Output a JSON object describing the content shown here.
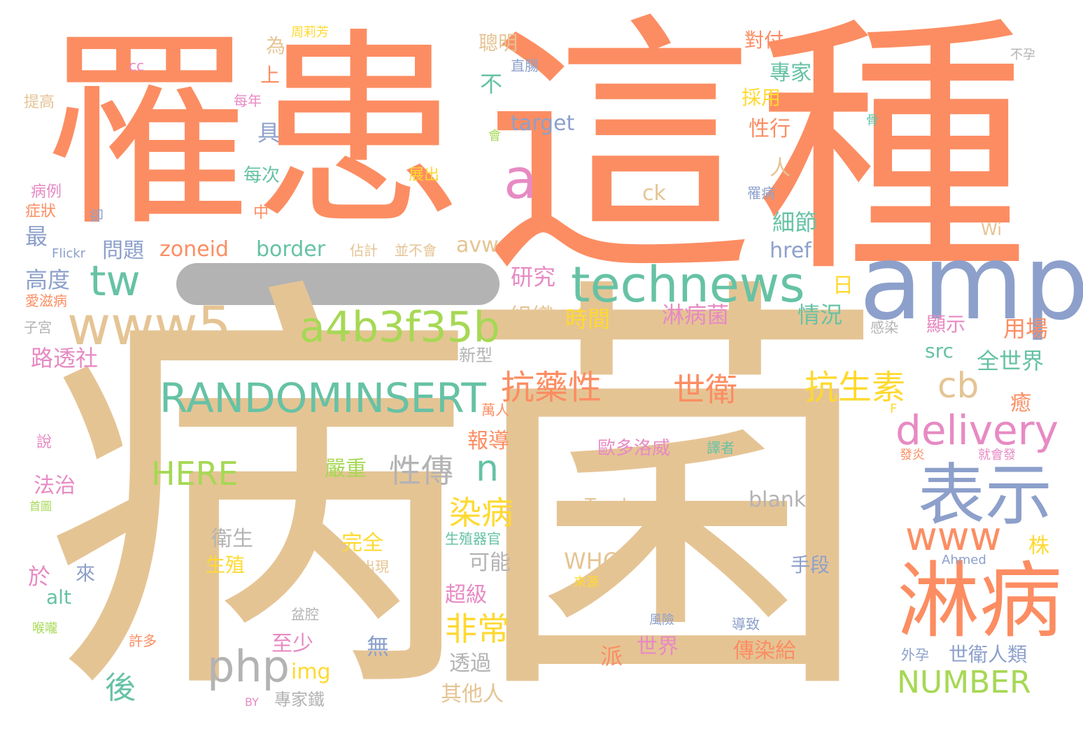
{
  "colors": {
    "orange": "#fc8d62",
    "tan": "#e5c494",
    "blue": "#8da0cb",
    "green": "#66c2a5",
    "pink": "#e78ac3",
    "lime": "#a6d854",
    "yellow": "#ffd92f",
    "gray": "#b3b3b3"
  },
  "words": {
    "w1": "罹患",
    "w2": "這種",
    "w3": "病菌",
    "w4": "amp",
    "w5": "淋病",
    "w6": "表示",
    "w7": "technews",
    "w8": "www5",
    "w9": "a4b3f35b",
    "w10": "RANDOMINSERT",
    "w11": "tw",
    "w12": "delivery",
    "w13": "www",
    "w14": "php",
    "w15": "抗藥性",
    "w16": "抗生素",
    "w17": "世衛",
    "w18": "NUMBER",
    "w19": "HERE",
    "w20": "a",
    "w21": "cb",
    "w22": "n",
    "w23": "性傳",
    "w24": "染病",
    "w25": "非常",
    "w26": "後",
    "w27": "淋病菌",
    "w28": "組織",
    "w29": "時間",
    "w30": "研究",
    "w31": "情況",
    "w32": "顯示",
    "w33": "用場",
    "w34": "全世界",
    "w35": "src",
    "w36": "路透社",
    "w37": "高度",
    "w38": "問題",
    "w39": "zoneid",
    "w40": "border",
    "w41": "avw",
    "w42": "href",
    "w43": "細節",
    "w44": "專家",
    "w45": "性行",
    "w46": "target",
    "w47": "ck",
    "w48": "聰明",
    "w49": "對付",
    "w50": "採用",
    "w51": "報導",
    "w52": "嚴重",
    "w53": "法治",
    "w54": "衛生",
    "w55": "可能",
    "w56": "完全",
    "w57": "超級",
    "w58": "至少",
    "w59": "透過",
    "w60": "其他人",
    "w61": "img",
    "w62": "生殖",
    "w63": "世界",
    "w64": "傳染給",
    "w65": "世衛人類",
    "w66": "手段",
    "w67": "WHO",
    "w68": "blank",
    "w69": "Teodora",
    "w70": "歐多洛威",
    "w71": "生殖器官",
    "w72": "每次",
    "w73": "展出",
    "w74": "佔計",
    "w75": "並不會",
    "w76": "新型",
    "w77": "萬人",
    "w78": "直腸",
    "w79": "每年",
    "w80": "提高",
    "w81": "病例",
    "w82": "症狀",
    "w83": "愛滋病",
    "w84": "子宮",
    "w85": "Flickr",
    "w86": "cc",
    "w87": "周莉芳",
    "w88": "不孕",
    "w89": "骨",
    "w90": "罹病",
    "w91": "Wi",
    "w92": "感染",
    "w93": "F",
    "w94": "發炎",
    "w95": "就會發",
    "w96": "譯者",
    "w97": "Ahmed",
    "w98": "來源",
    "w99": "風險",
    "w100": "導致",
    "w101": "外孕",
    "w102": "盆腔",
    "w103": "出現",
    "w104": "許多",
    "w105": "喉嚨",
    "w106": "首圖",
    "w107": "BY",
    "w108": "專家鐵",
    "w109": "說",
    "w110": "卻",
    "w111": "中",
    "w112": "會",
    "w113": "上",
    "w114": "為",
    "w115": "具",
    "w116": "最",
    "w117": "人",
    "w118": "不",
    "w119": "日",
    "w120": "無",
    "w121": "派",
    "w122": "於",
    "w123": "來",
    "w124": "alt",
    "w125": "株",
    "w126": "癒"
  }
}
